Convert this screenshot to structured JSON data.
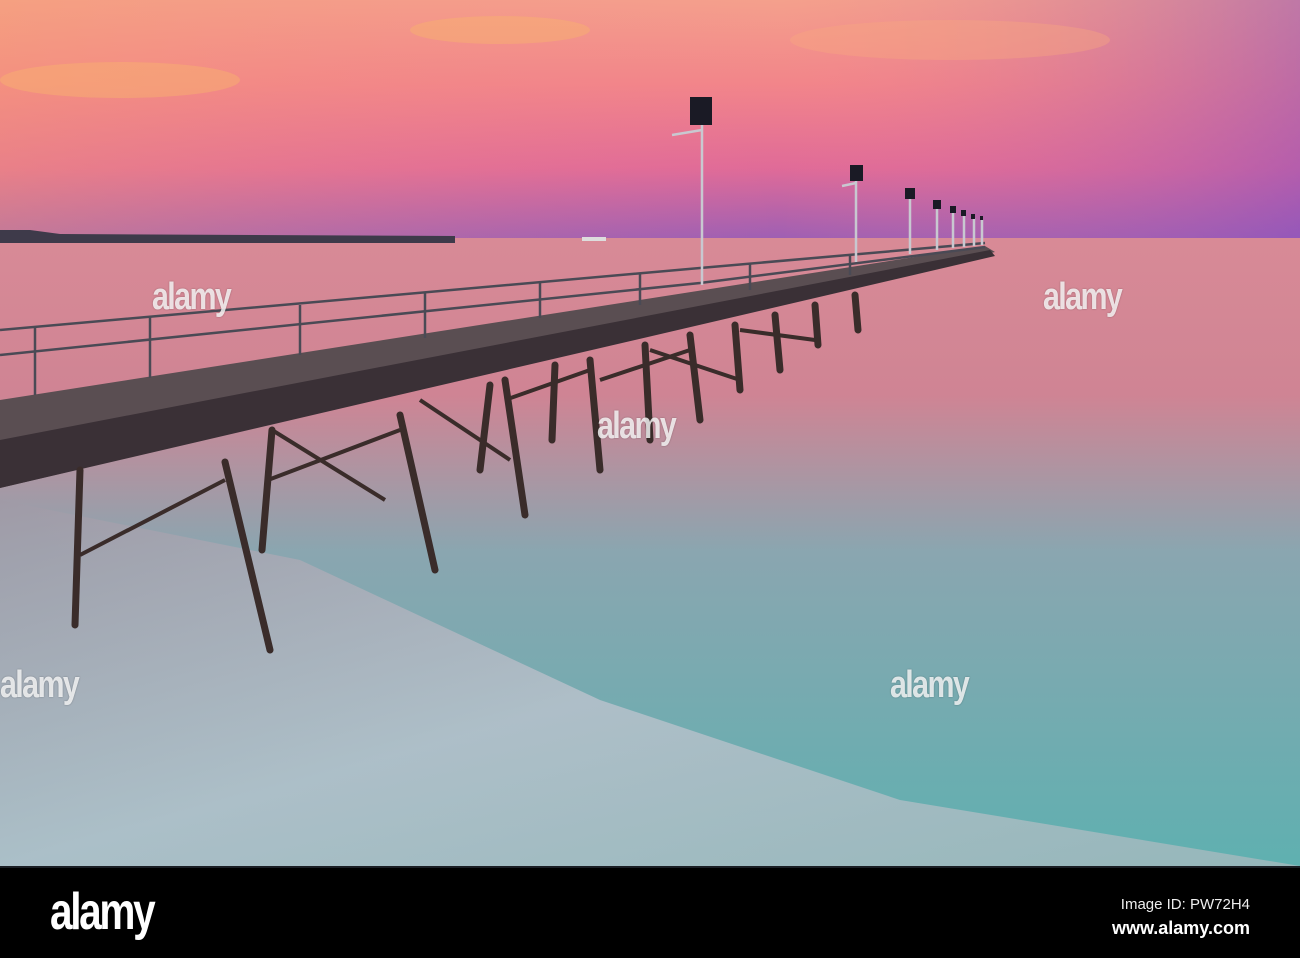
{
  "photo": {
    "subject": "pier-at-sunset",
    "colors": {
      "sky_top": "#f29a8a",
      "sky_horizon": "#9a5ab0",
      "water_pink": "#e08a98",
      "water_turquoise": "#5fb8b4",
      "sand": "#b9c3cc",
      "pier": "#3a3036"
    }
  },
  "watermark": {
    "text": "alamy"
  },
  "footer": {
    "logo": "alamy",
    "image_id": "Image ID: PW72H4",
    "url": "www.alamy.com"
  }
}
